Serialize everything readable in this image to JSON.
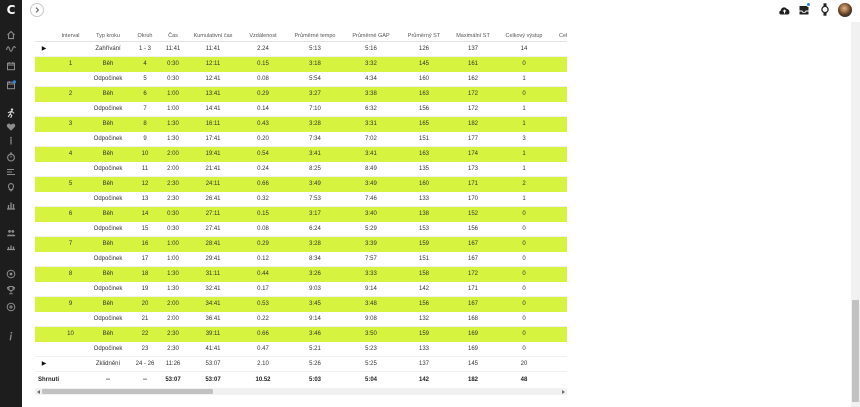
{
  "app": {
    "logo": "C"
  },
  "colors": {
    "sidebar_background": "#1d1d1d",
    "interval_row_highlight": "#d6f43f",
    "notification_badge": "#2f80ed"
  },
  "sidebar": {
    "icons": [
      "home-icon",
      "activity-wave-icon",
      "calendar-icon",
      "calendar-badge-icon",
      "runner-icon",
      "heart-icon",
      "bar-indicator-icon",
      "stopwatch-icon",
      "performance-icon",
      "lightbulb-icon",
      "reports-icon",
      "people-icon",
      "leaderboard-icon",
      "target-icon",
      "trophy-icon",
      "add-circle-icon",
      "info-icon"
    ]
  },
  "topbar": {
    "back_icon": "chevron-right-icon",
    "icons": [
      "cloud-upload-icon",
      "inbox-icon",
      "watch-icon",
      "user-avatar"
    ]
  },
  "table": {
    "columns": [
      "Interval",
      "Typ kroku",
      "Okruh",
      "Čas",
      "Kumulativní čas",
      "Vzdálenost",
      "Průměrné tempo",
      "Průměrné GAP",
      "Průměrný ST",
      "Maximální ST",
      "Celkový výstup",
      "Cel"
    ],
    "rows": [
      [
        "▶",
        "",
        "Zahřívání",
        "1 - 3",
        "11:41",
        "11:41",
        "2.24",
        "5:13",
        "5:16",
        "126",
        "137",
        "14"
      ],
      [
        "",
        "1",
        "Běh",
        "4",
        "0:30",
        "12:11",
        "0.15",
        "3:18",
        "3:32",
        "145",
        "161",
        "0"
      ],
      [
        "",
        "",
        "Odpočinek",
        "5",
        "0:30",
        "12:41",
        "0.08",
        "5:54",
        "4:34",
        "160",
        "162",
        "1"
      ],
      [
        "",
        "2",
        "Běh",
        "6",
        "1:00",
        "13:41",
        "0.29",
        "3:27",
        "3:38",
        "163",
        "172",
        "0"
      ],
      [
        "",
        "",
        "Odpočinek",
        "7",
        "1:00",
        "14:41",
        "0.14",
        "7:10",
        "6:32",
        "156",
        "172",
        "1"
      ],
      [
        "",
        "3",
        "Běh",
        "8",
        "1:30",
        "16:11",
        "0.43",
        "3:28",
        "3:31",
        "165",
        "182",
        "1"
      ],
      [
        "",
        "",
        "Odpočinek",
        "9",
        "1:30",
        "17:41",
        "0.20",
        "7:34",
        "7:02",
        "151",
        "177",
        "3"
      ],
      [
        "",
        "4",
        "Běh",
        "10",
        "2:00",
        "19:41",
        "0.54",
        "3:41",
        "3:41",
        "163",
        "174",
        "1"
      ],
      [
        "",
        "",
        "Odpočinek",
        "11",
        "2:00",
        "21:41",
        "0.24",
        "8:25",
        "8:49",
        "135",
        "173",
        "1"
      ],
      [
        "",
        "5",
        "Běh",
        "12",
        "2:30",
        "24:11",
        "0.66",
        "3:49",
        "3:49",
        "160",
        "171",
        "2"
      ],
      [
        "",
        "",
        "Odpočinek",
        "13",
        "2:30",
        "26:41",
        "0.32",
        "7:53",
        "7:46",
        "133",
        "170",
        "1"
      ],
      [
        "",
        "6",
        "Běh",
        "14",
        "0:30",
        "27:11",
        "0.15",
        "3:17",
        "3:40",
        "138",
        "152",
        "0"
      ],
      [
        "",
        "",
        "Odpočinek",
        "15",
        "0:30",
        "27:41",
        "0.08",
        "6:24",
        "5:29",
        "153",
        "156",
        "0"
      ],
      [
        "",
        "7",
        "Běh",
        "16",
        "1:00",
        "28:41",
        "0.29",
        "3:28",
        "3:39",
        "159",
        "167",
        "0"
      ],
      [
        "",
        "",
        "Odpočinek",
        "17",
        "1:00",
        "29:41",
        "0.12",
        "8:34",
        "7:57",
        "151",
        "167",
        "0"
      ],
      [
        "",
        "8",
        "Běh",
        "18",
        "1:30",
        "31:11",
        "0.44",
        "3:26",
        "3:33",
        "158",
        "172",
        "0"
      ],
      [
        "",
        "",
        "Odpočinek",
        "19",
        "1:30",
        "32:41",
        "0.17",
        "9:03",
        "9:14",
        "142",
        "171",
        "0"
      ],
      [
        "",
        "9",
        "Běh",
        "20",
        "2:00",
        "34:41",
        "0.53",
        "3:45",
        "3:48",
        "156",
        "167",
        "0"
      ],
      [
        "",
        "",
        "Odpočinek",
        "21",
        "2:00",
        "36:41",
        "0.22",
        "9:14",
        "9:08",
        "132",
        "168",
        "0"
      ],
      [
        "",
        "10",
        "Běh",
        "22",
        "2:30",
        "39:11",
        "0.66",
        "3:46",
        "3:50",
        "159",
        "169",
        "0"
      ],
      [
        "",
        "",
        "Odpočinek",
        "23",
        "2:30",
        "41:41",
        "0.47",
        "5:21",
        "5:23",
        "133",
        "169",
        "0"
      ],
      [
        "▶",
        "",
        "Zklidnění",
        "24 - 26",
        "11:26",
        "53:07",
        "2.10",
        "5:26",
        "5:25",
        "137",
        "145",
        "20"
      ]
    ],
    "summary": {
      "label": "Shrnutí",
      "cells": [
        "--",
        "--",
        "53:07",
        "53:07",
        "10.52",
        "5:03",
        "5:04",
        "142",
        "182",
        "48"
      ]
    }
  }
}
